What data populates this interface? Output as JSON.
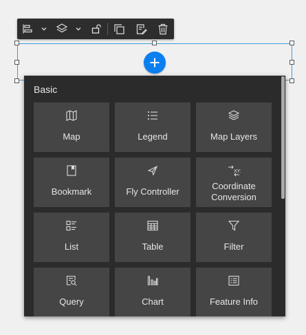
{
  "toolbar": {
    "buttons": [
      {
        "name": "align-left-icon"
      },
      {
        "name": "align-dropdown-chevron-icon"
      },
      {
        "name": "layers-icon"
      },
      {
        "name": "layers-dropdown-chevron-icon"
      },
      {
        "name": "unlock-icon"
      },
      {
        "name": "duplicate-icon"
      },
      {
        "name": "edit-copy-icon"
      },
      {
        "name": "delete-icon"
      }
    ]
  },
  "add_button": {
    "icon": "plus-icon",
    "color": "#0a7ff0"
  },
  "panel": {
    "title": "Basic",
    "tiles": [
      {
        "label": "Map",
        "icon": "map-icon"
      },
      {
        "label": "Legend",
        "icon": "legend-icon"
      },
      {
        "label": "Map Layers",
        "icon": "map-layers-icon"
      },
      {
        "label": "Bookmark",
        "icon": "bookmark-icon"
      },
      {
        "label": "Fly Controller",
        "icon": "fly-controller-icon"
      },
      {
        "label": "Coordinate\nConversion",
        "icon": "coordinate-conversion-icon"
      },
      {
        "label": "List",
        "icon": "list-icon"
      },
      {
        "label": "Table",
        "icon": "table-icon"
      },
      {
        "label": "Filter",
        "icon": "filter-icon"
      },
      {
        "label": "Query",
        "icon": "query-icon"
      },
      {
        "label": "Chart",
        "icon": "chart-icon"
      },
      {
        "label": "Feature Info",
        "icon": "feature-info-icon"
      }
    ]
  },
  "colors": {
    "selection": "#3a9bd6",
    "panel_bg": "#2b2b2b",
    "tile_bg": "#454545",
    "toolbar_bg": "#2d2d2d"
  }
}
